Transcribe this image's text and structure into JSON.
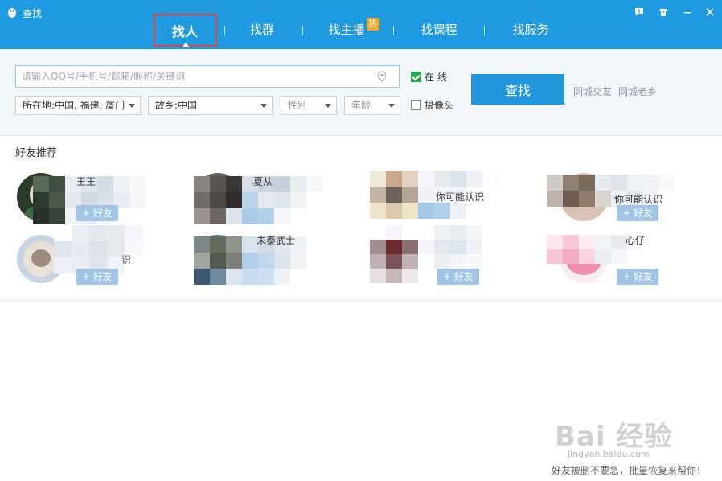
{
  "window": {
    "title": "查找",
    "controls": [
      "feedback-icon",
      "skin-icon",
      "minimize-icon",
      "close-icon"
    ]
  },
  "tabs": [
    {
      "label": "找人",
      "active": true
    },
    {
      "label": "找群",
      "active": false
    },
    {
      "label": "找主播",
      "badge": "热",
      "active": false
    },
    {
      "label": "找课程",
      "active": false
    },
    {
      "label": "找服务",
      "active": false
    }
  ],
  "search": {
    "placeholder": "请输入QQ号/手机号/邮箱/昵称/关键词",
    "value": "",
    "online_label": "在 线",
    "online_checked": true,
    "camera_label": "摄像头",
    "camera_checked": false,
    "location": "所在地:中国, 福建, 厦门",
    "hometown": "故乡:中国",
    "gender": "性别",
    "age": "年龄",
    "button": "查找",
    "link_local": "同城交友",
    "link_hometown": "同城老乡"
  },
  "recommend": {
    "title": "好友推荐",
    "add_label": "+ 好友",
    "cards": [
      {
        "name": "王王",
        "sub": ""
      },
      {
        "name": "夏从",
        "sub": ""
      },
      {
        "name": "",
        "sub": "你可能认识"
      },
      {
        "name": "",
        "sub": "你可能认识"
      },
      {
        "name": "",
        "sub": "识"
      },
      {
        "name": "未泰武士",
        "sub": ""
      },
      {
        "name": "",
        "sub": ""
      },
      {
        "name": "心仔",
        "sub": ""
      }
    ]
  },
  "watermark": {
    "brand": "Bai 经验",
    "url": "jingyan.baidu.com"
  },
  "footer": "好友被删不要急，批量恢复来帮你！",
  "colors": {
    "title_bar": "#1e9ae0",
    "accent": "#2196dd",
    "highlight_box": "#e0443c",
    "hot_badge": "#f5a623",
    "checkbox_checked": "#2aa94a"
  }
}
